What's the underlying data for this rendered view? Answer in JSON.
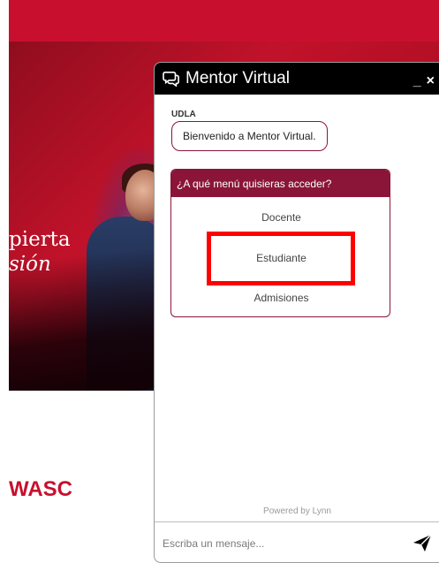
{
  "background": {
    "hero_line1": "pierta",
    "hero_line2": "sión",
    "accreditation": "WASC"
  },
  "chat": {
    "title": "Mentor Virtual",
    "minimize_label": "_",
    "close_label": "×",
    "sender": "UDLA",
    "welcome_message": "Bienvenido a Mentor Virtual.",
    "menu_question": "¿A qué menú quisieras acceder?",
    "menu_options": [
      "Docente",
      "Estudiante",
      "Admisiones"
    ],
    "powered_by": "Powered by Lynn",
    "input_placeholder": "Escriba un mensaje..."
  },
  "colors": {
    "brand_red": "#c8102e",
    "menu_burgundy": "#8a1538",
    "header_black": "#000000",
    "highlight_red": "#ff0000"
  }
}
